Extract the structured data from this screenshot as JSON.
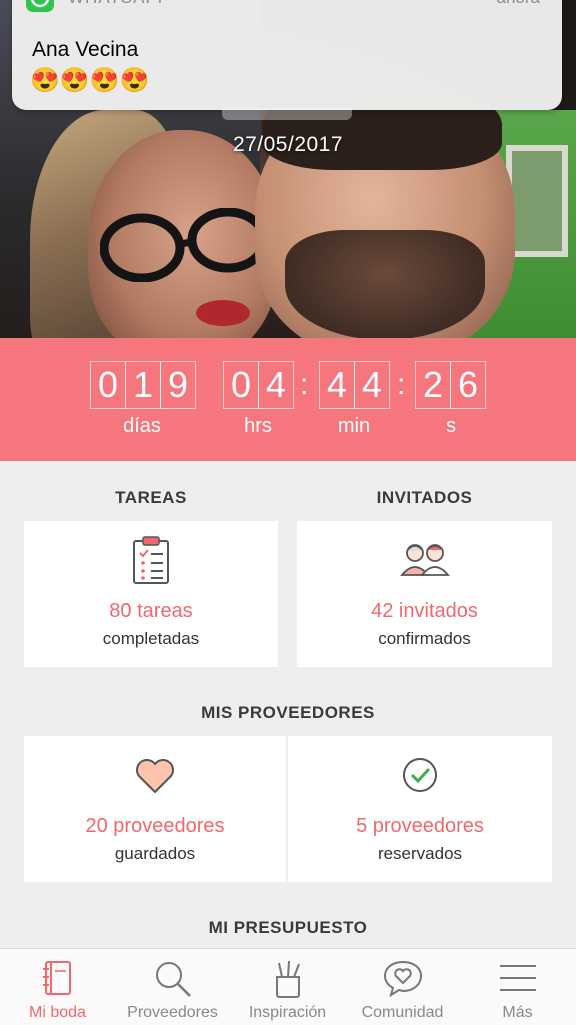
{
  "notification": {
    "app": "WHATSAPP",
    "time": "ahora",
    "title": "Ana Vecina",
    "body": "😍😍😍😍"
  },
  "hero": {
    "date": "27/05/2017"
  },
  "countdown": {
    "days": [
      "0",
      "1",
      "9"
    ],
    "hours": [
      "0",
      "4"
    ],
    "minutes": [
      "4",
      "4"
    ],
    "seconds": [
      "2",
      "6"
    ],
    "labels": {
      "days": "días",
      "hours": "hrs",
      "minutes": "min",
      "seconds": "s"
    }
  },
  "tasks": {
    "title": "TAREAS",
    "value": "80 tareas",
    "sub": "completadas",
    "icon": "clipboard-checklist-icon"
  },
  "guests": {
    "title": "INVITADOS",
    "value": "42 invitados",
    "sub": "confirmados",
    "icon": "guests-couple-icon"
  },
  "vendors": {
    "title": "MIS PROVEEDORES",
    "saved": {
      "value": "20 proveedores",
      "sub": "guardados",
      "icon": "heart-icon"
    },
    "booked": {
      "value": "5 proveedores",
      "sub": "reservados",
      "icon": "check-circle-icon"
    }
  },
  "budget": {
    "title": "MI PRESUPUESTO"
  },
  "tabbar": {
    "items": [
      {
        "label": "Mi boda",
        "icon": "notebook-icon",
        "active": true
      },
      {
        "label": "Proveedores",
        "icon": "search-icon",
        "active": false
      },
      {
        "label": "Inspiración",
        "icon": "brushes-cup-icon",
        "active": false
      },
      {
        "label": "Comunidad",
        "icon": "heart-chat-icon",
        "active": false
      },
      {
        "label": "Más",
        "icon": "menu-icon",
        "active": false
      }
    ]
  },
  "colors": {
    "accent": "#f6767e",
    "accent_text": "#f0686e",
    "background": "#efeeee"
  }
}
